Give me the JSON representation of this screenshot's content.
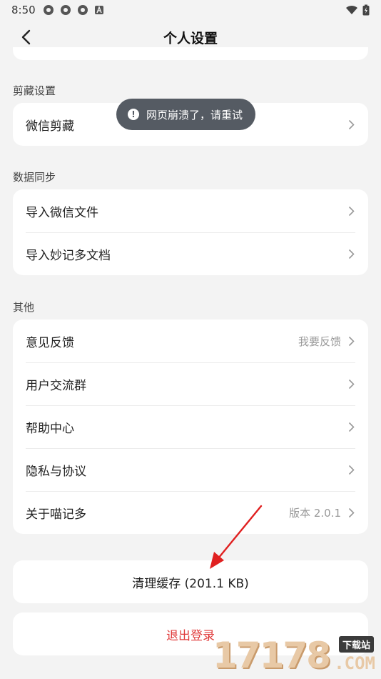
{
  "status": {
    "time": "8:50"
  },
  "header": {
    "title": "个人设置"
  },
  "sections": {
    "clip": {
      "label": "剪藏设置",
      "items": [
        {
          "label": "微信剪藏"
        }
      ]
    },
    "sync": {
      "label": "数据同步",
      "items": [
        {
          "label": "导入微信文件"
        },
        {
          "label": "导入妙记多文档"
        }
      ]
    },
    "other": {
      "label": "其他",
      "items": [
        {
          "label": "意见反馈",
          "value": "我要反馈"
        },
        {
          "label": "用户交流群"
        },
        {
          "label": "帮助中心"
        },
        {
          "label": "隐私与协议"
        },
        {
          "label": "关于喵记多",
          "value": "版本 2.0.1"
        }
      ]
    }
  },
  "actions": {
    "clear_cache": "清理缓存 (201.1 KB)",
    "logout": "退出登录"
  },
  "toast": {
    "text": "网页崩溃了，请重试",
    "icon": "exclamation-icon"
  },
  "watermark": {
    "number": "17178",
    "sub": "下载站",
    "domain": ".COM"
  },
  "colors": {
    "logout": "#e03a3a",
    "toast_bg": "#555b63",
    "arrow": "#e02020",
    "watermark": "#e8c9a6"
  }
}
